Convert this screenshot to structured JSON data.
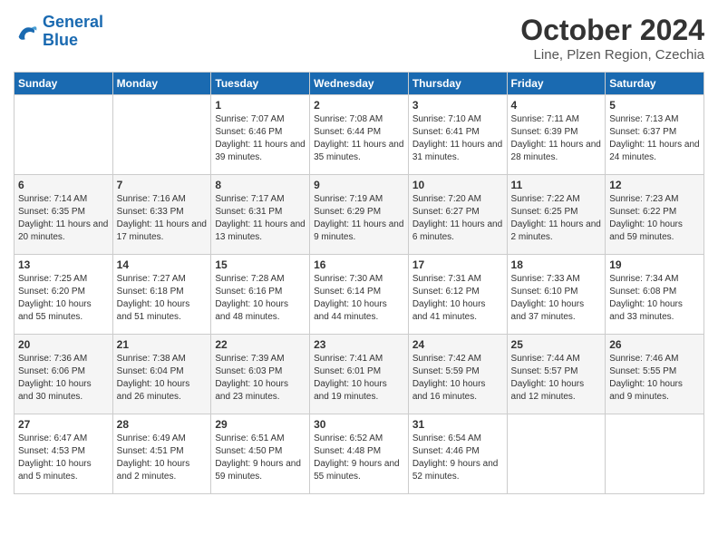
{
  "header": {
    "logo_line1": "General",
    "logo_line2": "Blue",
    "month": "October 2024",
    "location": "Line, Plzen Region, Czechia"
  },
  "weekdays": [
    "Sunday",
    "Monday",
    "Tuesday",
    "Wednesday",
    "Thursday",
    "Friday",
    "Saturday"
  ],
  "weeks": [
    [
      {
        "day": "",
        "text": ""
      },
      {
        "day": "",
        "text": ""
      },
      {
        "day": "1",
        "text": "Sunrise: 7:07 AM\nSunset: 6:46 PM\nDaylight: 11 hours and 39 minutes."
      },
      {
        "day": "2",
        "text": "Sunrise: 7:08 AM\nSunset: 6:44 PM\nDaylight: 11 hours and 35 minutes."
      },
      {
        "day": "3",
        "text": "Sunrise: 7:10 AM\nSunset: 6:41 PM\nDaylight: 11 hours and 31 minutes."
      },
      {
        "day": "4",
        "text": "Sunrise: 7:11 AM\nSunset: 6:39 PM\nDaylight: 11 hours and 28 minutes."
      },
      {
        "day": "5",
        "text": "Sunrise: 7:13 AM\nSunset: 6:37 PM\nDaylight: 11 hours and 24 minutes."
      }
    ],
    [
      {
        "day": "6",
        "text": "Sunrise: 7:14 AM\nSunset: 6:35 PM\nDaylight: 11 hours and 20 minutes."
      },
      {
        "day": "7",
        "text": "Sunrise: 7:16 AM\nSunset: 6:33 PM\nDaylight: 11 hours and 17 minutes."
      },
      {
        "day": "8",
        "text": "Sunrise: 7:17 AM\nSunset: 6:31 PM\nDaylight: 11 hours and 13 minutes."
      },
      {
        "day": "9",
        "text": "Sunrise: 7:19 AM\nSunset: 6:29 PM\nDaylight: 11 hours and 9 minutes."
      },
      {
        "day": "10",
        "text": "Sunrise: 7:20 AM\nSunset: 6:27 PM\nDaylight: 11 hours and 6 minutes."
      },
      {
        "day": "11",
        "text": "Sunrise: 7:22 AM\nSunset: 6:25 PM\nDaylight: 11 hours and 2 minutes."
      },
      {
        "day": "12",
        "text": "Sunrise: 7:23 AM\nSunset: 6:22 PM\nDaylight: 10 hours and 59 minutes."
      }
    ],
    [
      {
        "day": "13",
        "text": "Sunrise: 7:25 AM\nSunset: 6:20 PM\nDaylight: 10 hours and 55 minutes."
      },
      {
        "day": "14",
        "text": "Sunrise: 7:27 AM\nSunset: 6:18 PM\nDaylight: 10 hours and 51 minutes."
      },
      {
        "day": "15",
        "text": "Sunrise: 7:28 AM\nSunset: 6:16 PM\nDaylight: 10 hours and 48 minutes."
      },
      {
        "day": "16",
        "text": "Sunrise: 7:30 AM\nSunset: 6:14 PM\nDaylight: 10 hours and 44 minutes."
      },
      {
        "day": "17",
        "text": "Sunrise: 7:31 AM\nSunset: 6:12 PM\nDaylight: 10 hours and 41 minutes."
      },
      {
        "day": "18",
        "text": "Sunrise: 7:33 AM\nSunset: 6:10 PM\nDaylight: 10 hours and 37 minutes."
      },
      {
        "day": "19",
        "text": "Sunrise: 7:34 AM\nSunset: 6:08 PM\nDaylight: 10 hours and 33 minutes."
      }
    ],
    [
      {
        "day": "20",
        "text": "Sunrise: 7:36 AM\nSunset: 6:06 PM\nDaylight: 10 hours and 30 minutes."
      },
      {
        "day": "21",
        "text": "Sunrise: 7:38 AM\nSunset: 6:04 PM\nDaylight: 10 hours and 26 minutes."
      },
      {
        "day": "22",
        "text": "Sunrise: 7:39 AM\nSunset: 6:03 PM\nDaylight: 10 hours and 23 minutes."
      },
      {
        "day": "23",
        "text": "Sunrise: 7:41 AM\nSunset: 6:01 PM\nDaylight: 10 hours and 19 minutes."
      },
      {
        "day": "24",
        "text": "Sunrise: 7:42 AM\nSunset: 5:59 PM\nDaylight: 10 hours and 16 minutes."
      },
      {
        "day": "25",
        "text": "Sunrise: 7:44 AM\nSunset: 5:57 PM\nDaylight: 10 hours and 12 minutes."
      },
      {
        "day": "26",
        "text": "Sunrise: 7:46 AM\nSunset: 5:55 PM\nDaylight: 10 hours and 9 minutes."
      }
    ],
    [
      {
        "day": "27",
        "text": "Sunrise: 6:47 AM\nSunset: 4:53 PM\nDaylight: 10 hours and 5 minutes."
      },
      {
        "day": "28",
        "text": "Sunrise: 6:49 AM\nSunset: 4:51 PM\nDaylight: 10 hours and 2 minutes."
      },
      {
        "day": "29",
        "text": "Sunrise: 6:51 AM\nSunset: 4:50 PM\nDaylight: 9 hours and 59 minutes."
      },
      {
        "day": "30",
        "text": "Sunrise: 6:52 AM\nSunset: 4:48 PM\nDaylight: 9 hours and 55 minutes."
      },
      {
        "day": "31",
        "text": "Sunrise: 6:54 AM\nSunset: 4:46 PM\nDaylight: 9 hours and 52 minutes."
      },
      {
        "day": "",
        "text": ""
      },
      {
        "day": "",
        "text": ""
      }
    ]
  ]
}
